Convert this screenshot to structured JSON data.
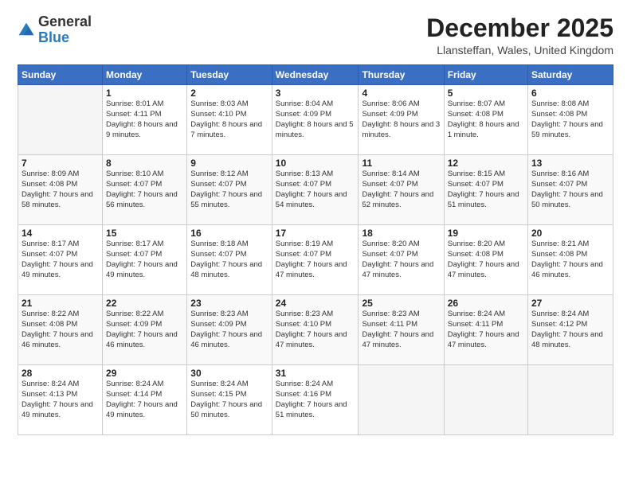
{
  "logo": {
    "general": "General",
    "blue": "Blue"
  },
  "header": {
    "month": "December 2025",
    "location": "Llansteffan, Wales, United Kingdom"
  },
  "days_of_week": [
    "Sunday",
    "Monday",
    "Tuesday",
    "Wednesday",
    "Thursday",
    "Friday",
    "Saturday"
  ],
  "weeks": [
    [
      {
        "day": "",
        "sunrise": "",
        "sunset": "",
        "daylight": ""
      },
      {
        "day": "1",
        "sunrise": "Sunrise: 8:01 AM",
        "sunset": "Sunset: 4:11 PM",
        "daylight": "Daylight: 8 hours and 9 minutes."
      },
      {
        "day": "2",
        "sunrise": "Sunrise: 8:03 AM",
        "sunset": "Sunset: 4:10 PM",
        "daylight": "Daylight: 8 hours and 7 minutes."
      },
      {
        "day": "3",
        "sunrise": "Sunrise: 8:04 AM",
        "sunset": "Sunset: 4:09 PM",
        "daylight": "Daylight: 8 hours and 5 minutes."
      },
      {
        "day": "4",
        "sunrise": "Sunrise: 8:06 AM",
        "sunset": "Sunset: 4:09 PM",
        "daylight": "Daylight: 8 hours and 3 minutes."
      },
      {
        "day": "5",
        "sunrise": "Sunrise: 8:07 AM",
        "sunset": "Sunset: 4:08 PM",
        "daylight": "Daylight: 8 hours and 1 minute."
      },
      {
        "day": "6",
        "sunrise": "Sunrise: 8:08 AM",
        "sunset": "Sunset: 4:08 PM",
        "daylight": "Daylight: 7 hours and 59 minutes."
      }
    ],
    [
      {
        "day": "7",
        "sunrise": "Sunrise: 8:09 AM",
        "sunset": "Sunset: 4:08 PM",
        "daylight": "Daylight: 7 hours and 58 minutes."
      },
      {
        "day": "8",
        "sunrise": "Sunrise: 8:10 AM",
        "sunset": "Sunset: 4:07 PM",
        "daylight": "Daylight: 7 hours and 56 minutes."
      },
      {
        "day": "9",
        "sunrise": "Sunrise: 8:12 AM",
        "sunset": "Sunset: 4:07 PM",
        "daylight": "Daylight: 7 hours and 55 minutes."
      },
      {
        "day": "10",
        "sunrise": "Sunrise: 8:13 AM",
        "sunset": "Sunset: 4:07 PM",
        "daylight": "Daylight: 7 hours and 54 minutes."
      },
      {
        "day": "11",
        "sunrise": "Sunrise: 8:14 AM",
        "sunset": "Sunset: 4:07 PM",
        "daylight": "Daylight: 7 hours and 52 minutes."
      },
      {
        "day": "12",
        "sunrise": "Sunrise: 8:15 AM",
        "sunset": "Sunset: 4:07 PM",
        "daylight": "Daylight: 7 hours and 51 minutes."
      },
      {
        "day": "13",
        "sunrise": "Sunrise: 8:16 AM",
        "sunset": "Sunset: 4:07 PM",
        "daylight": "Daylight: 7 hours and 50 minutes."
      }
    ],
    [
      {
        "day": "14",
        "sunrise": "Sunrise: 8:17 AM",
        "sunset": "Sunset: 4:07 PM",
        "daylight": "Daylight: 7 hours and 49 minutes."
      },
      {
        "day": "15",
        "sunrise": "Sunrise: 8:17 AM",
        "sunset": "Sunset: 4:07 PM",
        "daylight": "Daylight: 7 hours and 49 minutes."
      },
      {
        "day": "16",
        "sunrise": "Sunrise: 8:18 AM",
        "sunset": "Sunset: 4:07 PM",
        "daylight": "Daylight: 7 hours and 48 minutes."
      },
      {
        "day": "17",
        "sunrise": "Sunrise: 8:19 AM",
        "sunset": "Sunset: 4:07 PM",
        "daylight": "Daylight: 7 hours and 47 minutes."
      },
      {
        "day": "18",
        "sunrise": "Sunrise: 8:20 AM",
        "sunset": "Sunset: 4:07 PM",
        "daylight": "Daylight: 7 hours and 47 minutes."
      },
      {
        "day": "19",
        "sunrise": "Sunrise: 8:20 AM",
        "sunset": "Sunset: 4:08 PM",
        "daylight": "Daylight: 7 hours and 47 minutes."
      },
      {
        "day": "20",
        "sunrise": "Sunrise: 8:21 AM",
        "sunset": "Sunset: 4:08 PM",
        "daylight": "Daylight: 7 hours and 46 minutes."
      }
    ],
    [
      {
        "day": "21",
        "sunrise": "Sunrise: 8:22 AM",
        "sunset": "Sunset: 4:08 PM",
        "daylight": "Daylight: 7 hours and 46 minutes."
      },
      {
        "day": "22",
        "sunrise": "Sunrise: 8:22 AM",
        "sunset": "Sunset: 4:09 PM",
        "daylight": "Daylight: 7 hours and 46 minutes."
      },
      {
        "day": "23",
        "sunrise": "Sunrise: 8:23 AM",
        "sunset": "Sunset: 4:09 PM",
        "daylight": "Daylight: 7 hours and 46 minutes."
      },
      {
        "day": "24",
        "sunrise": "Sunrise: 8:23 AM",
        "sunset": "Sunset: 4:10 PM",
        "daylight": "Daylight: 7 hours and 47 minutes."
      },
      {
        "day": "25",
        "sunrise": "Sunrise: 8:23 AM",
        "sunset": "Sunset: 4:11 PM",
        "daylight": "Daylight: 7 hours and 47 minutes."
      },
      {
        "day": "26",
        "sunrise": "Sunrise: 8:24 AM",
        "sunset": "Sunset: 4:11 PM",
        "daylight": "Daylight: 7 hours and 47 minutes."
      },
      {
        "day": "27",
        "sunrise": "Sunrise: 8:24 AM",
        "sunset": "Sunset: 4:12 PM",
        "daylight": "Daylight: 7 hours and 48 minutes."
      }
    ],
    [
      {
        "day": "28",
        "sunrise": "Sunrise: 8:24 AM",
        "sunset": "Sunset: 4:13 PM",
        "daylight": "Daylight: 7 hours and 49 minutes."
      },
      {
        "day": "29",
        "sunrise": "Sunrise: 8:24 AM",
        "sunset": "Sunset: 4:14 PM",
        "daylight": "Daylight: 7 hours and 49 minutes."
      },
      {
        "day": "30",
        "sunrise": "Sunrise: 8:24 AM",
        "sunset": "Sunset: 4:15 PM",
        "daylight": "Daylight: 7 hours and 50 minutes."
      },
      {
        "day": "31",
        "sunrise": "Sunrise: 8:24 AM",
        "sunset": "Sunset: 4:16 PM",
        "daylight": "Daylight: 7 hours and 51 minutes."
      },
      {
        "day": "",
        "sunrise": "",
        "sunset": "",
        "daylight": ""
      },
      {
        "day": "",
        "sunrise": "",
        "sunset": "",
        "daylight": ""
      },
      {
        "day": "",
        "sunrise": "",
        "sunset": "",
        "daylight": ""
      }
    ]
  ]
}
